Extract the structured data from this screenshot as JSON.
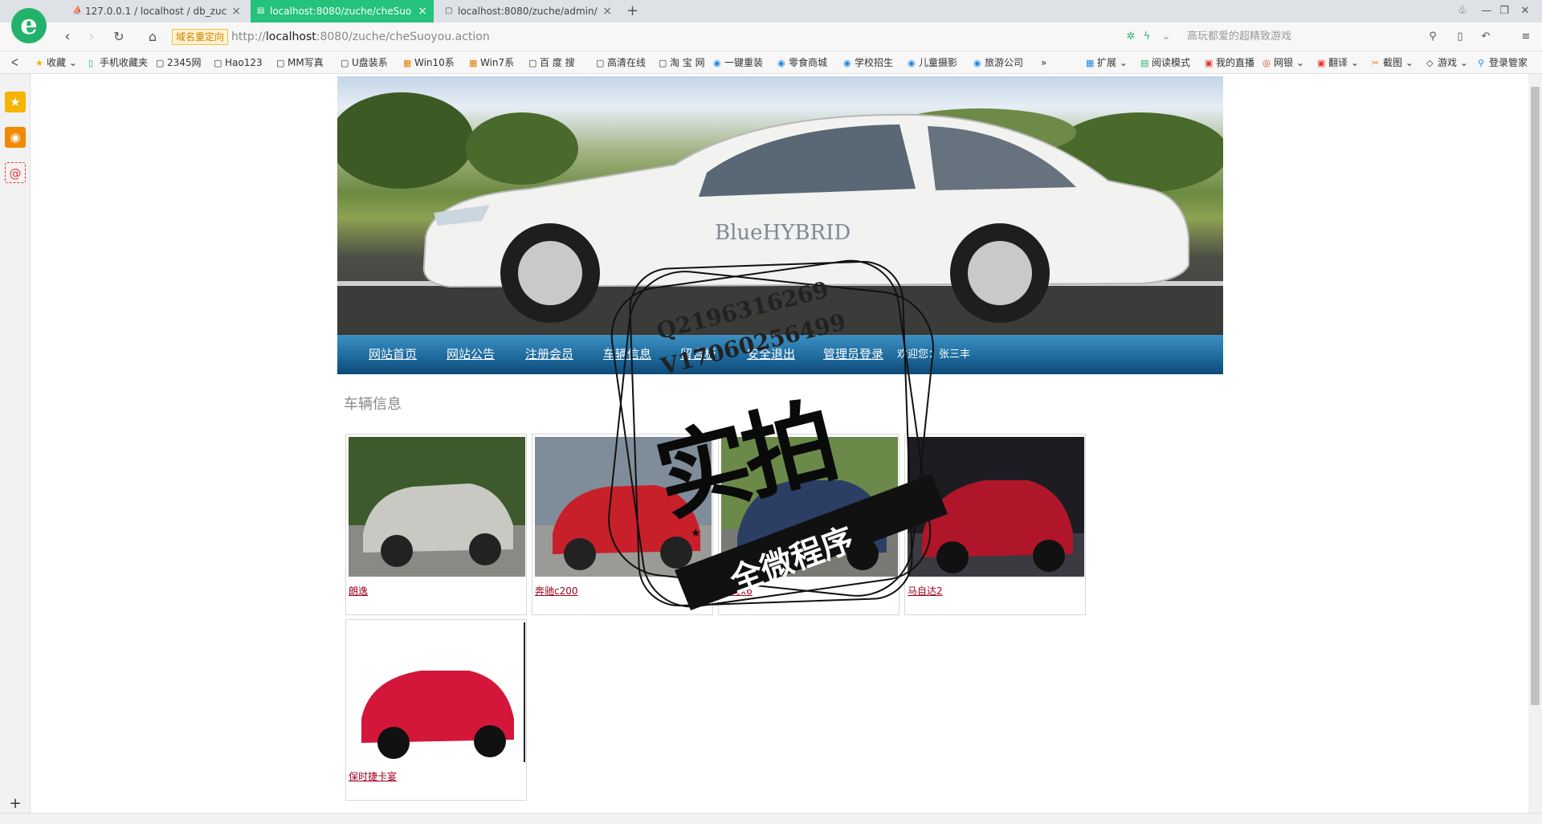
{
  "browser": {
    "tabs": [
      {
        "label": "127.0.0.1 / localhost / db_zuc",
        "icon": "phpmyadmin-icon",
        "active": false
      },
      {
        "label": "localhost:8080/zuche/cheSuo",
        "icon": "page-icon",
        "active": true
      },
      {
        "label": "localhost:8080/zuche/admin/",
        "icon": "page-icon",
        "active": false
      }
    ],
    "new_tab": "+",
    "redirect_badge": "域名重定向",
    "url_prefix": "http://",
    "url_host": "localhost",
    "url_path": ":8080/zuche/cheSuoyou.action",
    "search_placeholder": "高玩都爱的超精致游戏",
    "bookmarks": [
      "收藏",
      "手机收藏夹",
      "2345网",
      "Hao123",
      "MM写真",
      "U盘装系",
      "Win10系",
      "Win7系",
      "百 度 搜",
      "高清在线",
      "淘 宝 网",
      "一键重装",
      "零食商城",
      "学校招生",
      "儿童摄影",
      "旅游公司"
    ],
    "bookmarks_more": "»",
    "right_tools": [
      "扩展",
      "阅读模式",
      "我的直播",
      "网银",
      "翻译",
      "截图",
      "游戏",
      "登录管家"
    ]
  },
  "site": {
    "banner_car_text": "BlueHYBRID",
    "menu": [
      "网站首页",
      "网站公告",
      "注册会员",
      "车辆信息",
      "留言板",
      "安全退出",
      "管理员登录"
    ],
    "welcome": "欢迎您：张三丰",
    "section_title": "车辆信息",
    "cars": [
      {
        "name": "朗逸",
        "color": "#c9c9c4"
      },
      {
        "name": "奔驰c200",
        "color": "#c8202a"
      },
      {
        "name": "宝马x6",
        "color": "#2c3e64"
      },
      {
        "name": "马自达2",
        "color": "#b0162a"
      },
      {
        "name": "保时捷卡宴",
        "color": "#d4163a"
      }
    ]
  },
  "watermark": {
    "line1": "Q2196316269",
    "line2": "V17060256499",
    "big": "实拍",
    "ribbon": "全微程序"
  },
  "colors": {
    "tab_active": "#24c27a",
    "menu_bar": "#1f6b9e",
    "car_link": "#a0001e"
  }
}
